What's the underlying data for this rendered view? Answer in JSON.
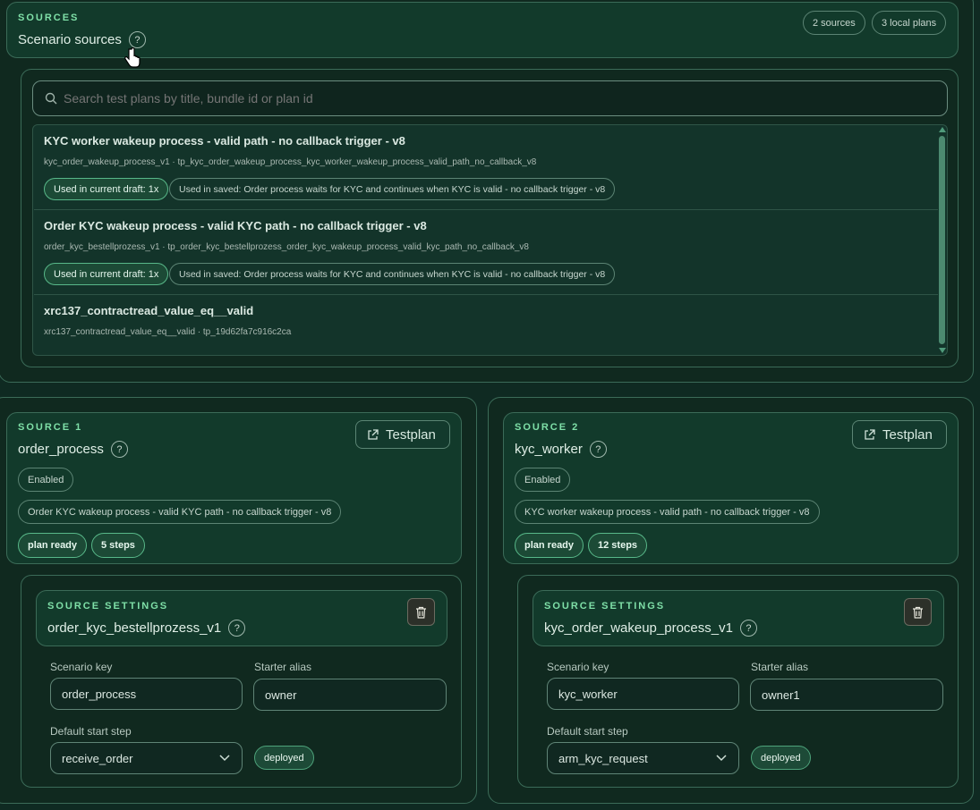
{
  "sources": {
    "eyebrow": "SOURCES",
    "title": "Scenario sources",
    "help": "?",
    "count_badge": "2 sources",
    "plans_badge": "3 local plans"
  },
  "search": {
    "placeholder": "Search test plans by title, bundle id or plan id"
  },
  "plans": [
    {
      "title": "KYC worker wakeup process - valid path - no callback trigger - v8",
      "sub": "kyc_order_wakeup_process_v1 · tp_kyc_order_wakeup_process_kyc_worker_wakeup_process_valid_path_no_callback_v8",
      "badge_draft": "Used in current draft: 1x",
      "badge_saved": "Used in saved: Order process waits for KYC and continues when KYC is valid - no callback trigger - v8"
    },
    {
      "title": "Order KYC wakeup process - valid KYC path - no callback trigger - v8",
      "sub": "order_kyc_bestellprozess_v1 · tp_order_kyc_bestellprozess_order_kyc_wakeup_process_valid_kyc_path_no_callback_v8",
      "badge_draft": "Used in current draft: 1x",
      "badge_saved": "Used in saved: Order process waits for KYC and continues when KYC is valid - no callback trigger - v8"
    },
    {
      "title": "xrc137_contractread_value_eq__valid",
      "sub": "xrc137_contractread_value_eq__valid · tp_19d62fa7c916c2ca"
    }
  ],
  "source_cards": [
    {
      "eyebrow": "SOURCE 1",
      "title": "order_process",
      "help": "?",
      "testplan_label": "Testplan",
      "enabled": "Enabled",
      "plan_name": "Order KYC wakeup process - valid KYC path - no callback trigger - v8",
      "status": "plan ready",
      "steps": "5 steps",
      "settings": {
        "eyebrow": "SOURCE SETTINGS",
        "title": "order_kyc_bestellprozess_v1",
        "help": "?",
        "scenario_key_label": "Scenario key",
        "scenario_key": "order_process",
        "starter_alias_label": "Starter alias",
        "starter_alias": "owner",
        "start_step_label": "Default start step",
        "start_step": "receive_order",
        "deploy_state": "deployed"
      }
    },
    {
      "eyebrow": "SOURCE 2",
      "title": "kyc_worker",
      "help": "?",
      "testplan_label": "Testplan",
      "enabled": "Enabled",
      "plan_name": "KYC worker wakeup process - valid path - no callback trigger - v8",
      "status": "plan ready",
      "steps": "12 steps",
      "settings": {
        "eyebrow": "SOURCE SETTINGS",
        "title": "kyc_order_wakeup_process_v1",
        "help": "?",
        "scenario_key_label": "Scenario key",
        "scenario_key": "kyc_worker",
        "starter_alias_label": "Starter alias",
        "starter_alias": "owner1",
        "start_step_label": "Default start step",
        "start_step": "arm_kyc_request",
        "deploy_state": "deployed"
      }
    }
  ],
  "icons": {
    "search": "search-icon",
    "external": "external-link-icon",
    "trash": "trash-icon",
    "chevron": "chevron-down-icon",
    "cursor": "hand-cursor-icon"
  },
  "colors": {
    "background": "#0f2a22",
    "accent": "#7fe0a8",
    "badge_green": "#1c4a36"
  }
}
